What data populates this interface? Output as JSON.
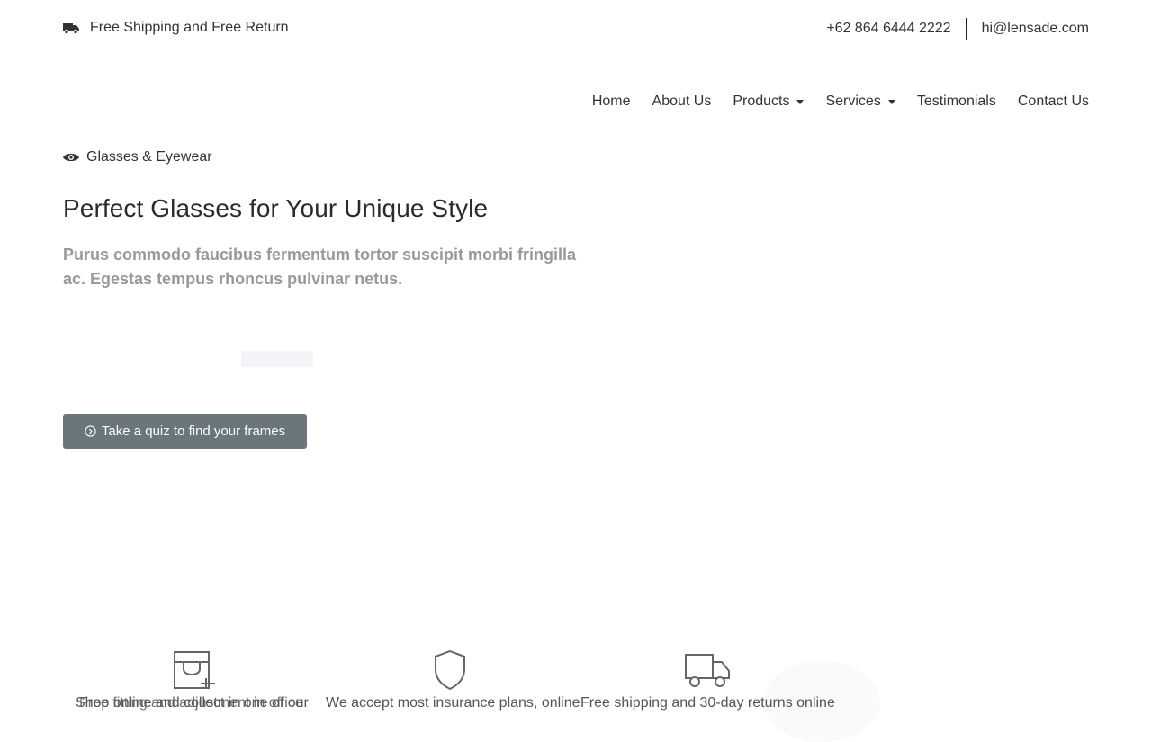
{
  "topbar": {
    "shipping_text": "Free Shipping and Free Return",
    "phone": "+62 864 6444 2222",
    "email": "hi@lensade.com"
  },
  "nav": {
    "items": [
      {
        "label": "Home"
      },
      {
        "label": "About Us"
      },
      {
        "label": "Products",
        "has_dropdown": true
      },
      {
        "label": "Services",
        "has_dropdown": true
      },
      {
        "label": "Testimonials"
      },
      {
        "label": "Contact Us"
      }
    ]
  },
  "hero": {
    "eyebrow": "Glasses & Eyewear",
    "title": "Perfect Glasses for Your Unique Style",
    "subtitle": "Purus commodo faucibus fermentum tortor suscipit morbi fringilla ac. Egestas tempus rhoncus pulvinar netus.",
    "cta_label": "Take a quiz to find your frames"
  },
  "features": [
    {
      "icon": "store-icon",
      "text_a": "Shop online and collect in one of our",
      "text_b": "Free fitting and adjustment in office"
    },
    {
      "icon": "shield-icon",
      "text": "We accept most insurance plans, online"
    },
    {
      "icon": "truck-icon",
      "text": "Free shipping and 30-day returns online"
    }
  ],
  "colors": {
    "button_bg": "#6b757c",
    "subtitle": "#999999",
    "text": "#333333"
  }
}
